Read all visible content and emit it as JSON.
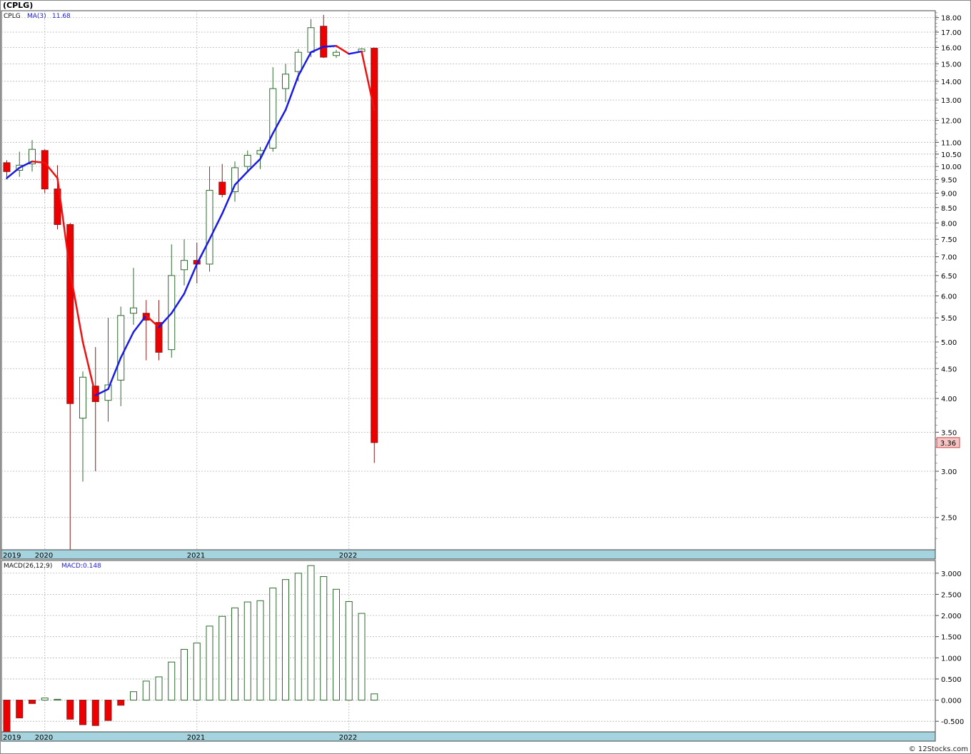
{
  "header": {
    "title": "(CPLG)",
    "watermark": "© 12Stocks.com"
  },
  "price_panel": {
    "legend_symbol": "CPLG",
    "legend_ma_label": "MA(3)",
    "legend_ma_value": "11.68",
    "last_price_label": "3.36"
  },
  "macd_panel": {
    "legend_name": "MACD(26,12,9)",
    "legend_value": "MACD:0.148"
  },
  "colors": {
    "up_candle_stroke": "#2e6b2e",
    "down_candle_fill": "#ee0000",
    "ma_up": "#1a1ae6",
    "ma_down": "#ee1111",
    "time_strip": "#a6d4de",
    "grid": "#b4b4b4"
  },
  "chart_data": [
    {
      "type": "candlestick",
      "title": "(CPLG)",
      "scale": "log",
      "ylim": [
        2.2,
        18.5
      ],
      "y_ticks": [
        "2.50",
        "3.00",
        "3.50",
        "4.00",
        "4.50",
        "5.00",
        "5.50",
        "6.00",
        "6.50",
        "7.00",
        "7.50",
        "8.00",
        "8.50",
        "9.00",
        "9.50",
        "10.00",
        "10.50",
        "11.00",
        "12.00",
        "13.00",
        "14.00",
        "15.00",
        "16.00",
        "17.00",
        "18.00"
      ],
      "x_labels": [
        "2019",
        "2020",
        "2021",
        "2022"
      ],
      "grid": true,
      "series": [
        {
          "name": "CPLG",
          "candles": [
            {
              "date": "2019-10",
              "o": 10.15,
              "h": 10.25,
              "l": 9.5,
              "c": 9.8
            },
            {
              "date": "2019-11",
              "o": 9.85,
              "h": 10.6,
              "l": 9.6,
              "c": 10.05
            },
            {
              "date": "2019-12",
              "o": 10.1,
              "h": 11.1,
              "l": 9.8,
              "c": 10.7
            },
            {
              "date": "2020-01",
              "o": 10.65,
              "h": 10.7,
              "l": 9.0,
              "c": 9.15
            },
            {
              "date": "2020-02",
              "o": 9.15,
              "h": 10.05,
              "l": 7.8,
              "c": 7.95
            },
            {
              "date": "2020-03",
              "o": 7.95,
              "h": 8.0,
              "l": 2.2,
              "c": 3.92
            },
            {
              "date": "2020-04",
              "o": 3.7,
              "h": 4.45,
              "l": 2.88,
              "c": 4.35
            },
            {
              "date": "2020-05",
              "o": 4.2,
              "h": 4.9,
              "l": 3.0,
              "c": 3.95
            },
            {
              "date": "2020-06",
              "o": 3.97,
              "h": 5.5,
              "l": 3.65,
              "c": 4.22
            },
            {
              "date": "2020-07",
              "o": 4.3,
              "h": 5.75,
              "l": 3.88,
              "c": 5.55
            },
            {
              "date": "2020-08",
              "o": 5.6,
              "h": 6.7,
              "l": 5.35,
              "c": 5.72
            },
            {
              "date": "2020-09",
              "o": 5.6,
              "h": 5.9,
              "l": 4.65,
              "c": 5.45
            },
            {
              "date": "2020-10",
              "o": 5.4,
              "h": 5.9,
              "l": 4.65,
              "c": 4.8
            },
            {
              "date": "2020-11",
              "o": 4.85,
              "h": 7.35,
              "l": 4.7,
              "c": 6.5
            },
            {
              "date": "2020-12",
              "o": 6.65,
              "h": 7.5,
              "l": 6.25,
              "c": 6.9
            },
            {
              "date": "2021-01",
              "o": 6.9,
              "h": 7.4,
              "l": 6.3,
              "c": 6.8
            },
            {
              "date": "2021-02",
              "o": 6.8,
              "h": 10.0,
              "l": 6.6,
              "c": 9.1
            },
            {
              "date": "2021-03",
              "o": 9.4,
              "h": 10.1,
              "l": 8.85,
              "c": 8.95
            },
            {
              "date": "2021-04",
              "o": 9.05,
              "h": 10.2,
              "l": 8.7,
              "c": 9.95
            },
            {
              "date": "2021-05",
              "o": 10.0,
              "h": 10.65,
              "l": 9.8,
              "c": 10.45
            },
            {
              "date": "2021-06",
              "o": 10.5,
              "h": 10.8,
              "l": 9.9,
              "c": 10.65
            },
            {
              "date": "2021-07",
              "o": 10.75,
              "h": 14.8,
              "l": 10.6,
              "c": 13.6
            },
            {
              "date": "2021-08",
              "o": 13.6,
              "h": 15.0,
              "l": 12.9,
              "c": 14.4
            },
            {
              "date": "2021-09",
              "o": 14.55,
              "h": 15.9,
              "l": 14.0,
              "c": 15.7
            },
            {
              "date": "2021-10",
              "o": 15.7,
              "h": 17.9,
              "l": 15.4,
              "c": 17.3
            },
            {
              "date": "2021-11",
              "o": 17.4,
              "h": 18.2,
              "l": 15.35,
              "c": 15.4
            },
            {
              "date": "2021-12",
              "o": 15.5,
              "h": 15.85,
              "l": 15.35,
              "c": 15.7
            },
            {
              "date": "2022-01",
              "o": null,
              "h": null,
              "l": null,
              "c": null
            },
            {
              "date": "2022-02",
              "o": 15.75,
              "h": 15.95,
              "l": 15.7,
              "c": 15.9
            },
            {
              "date": "2022-03",
              "o": 15.95,
              "h": 16.0,
              "l": 3.1,
              "c": 3.36
            }
          ]
        },
        {
          "name": "MA(3)",
          "values": [
            9.55,
            9.95,
            10.2,
            10.15,
            9.55,
            6.6,
            5.0,
            4.05,
            4.15,
            4.7,
            5.2,
            5.55,
            5.3,
            5.6,
            6.05,
            6.8,
            7.5,
            8.3,
            9.3,
            9.8,
            10.3,
            11.4,
            12.5,
            14.3,
            15.7,
            16.05,
            16.1,
            15.6,
            15.75,
            12.5
          ]
        }
      ]
    },
    {
      "type": "bar",
      "title": "MACD(26,12,9)",
      "ylim": [
        -0.75,
        3.3
      ],
      "y_ticks": [
        "-0.500",
        "0.000",
        "0.500",
        "1.000",
        "1.500",
        "2.000",
        "2.500",
        "3.000"
      ],
      "x_labels": [
        "2019",
        "2020",
        "2021",
        "2022"
      ],
      "series": [
        {
          "name": "MACD",
          "values": [
            -0.75,
            -0.42,
            -0.08,
            0.05,
            0.02,
            -0.45,
            -0.58,
            -0.6,
            -0.48,
            -0.12,
            0.2,
            0.45,
            0.55,
            0.9,
            1.2,
            1.35,
            1.75,
            1.98,
            2.18,
            2.32,
            2.35,
            2.65,
            2.85,
            3.0,
            3.18,
            2.92,
            2.62,
            2.33,
            2.05,
            0.148
          ]
        }
      ]
    }
  ]
}
